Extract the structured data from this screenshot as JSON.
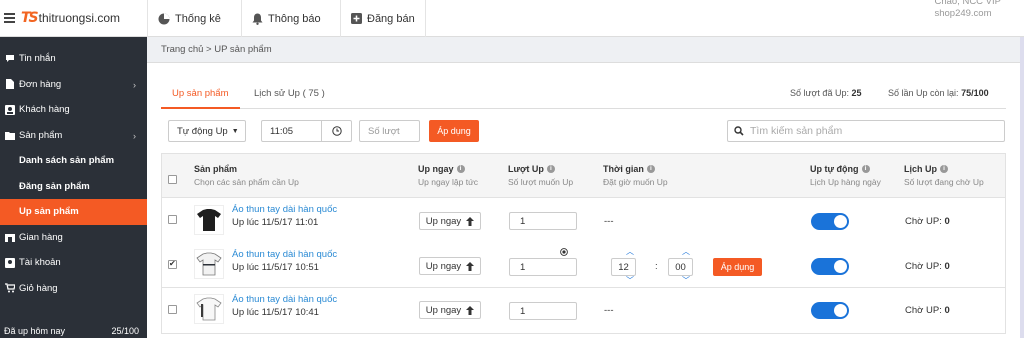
{
  "brand": {
    "name": "thitruongsi.com",
    "accent": "#f45a24"
  },
  "topbar": {
    "stats_label": "Thống kê",
    "notify_label": "Thông báo",
    "sell_label": "Đăng bán",
    "greeting": "Chào, NCC VIP",
    "shop": "shop249.com"
  },
  "sidebar": {
    "items": [
      {
        "label": "Tin nhắn",
        "icon": "chat-icon"
      },
      {
        "label": "Đơn hàng",
        "icon": "document-icon"
      },
      {
        "label": "Khách hàng",
        "icon": "contact-icon"
      },
      {
        "label": "Sản phẩm",
        "icon": "folder-icon"
      },
      {
        "label": "Danh sách sản phẩm"
      },
      {
        "label": "Đăng sản phẩm"
      },
      {
        "label": "Up sản phẩm"
      },
      {
        "label": "Gian hàng",
        "icon": "store-icon"
      },
      {
        "label": "Tài khoản",
        "icon": "account-icon"
      },
      {
        "label": "Giỏ hàng",
        "icon": "cart-icon"
      }
    ],
    "footer_label": "Đã up hôm nay",
    "footer_value": "25/100"
  },
  "breadcrumb": "Trang chủ > UP sản phẩm",
  "tabs": {
    "up": "Up sản phẩm",
    "history": "Lịch sử Up ( 75 )"
  },
  "stats": {
    "used_label": "Số lượt đã Up:",
    "used_value": "25",
    "remaining_label": "Số lần Up còn lại:",
    "remaining_value": "75/100"
  },
  "controls": {
    "mode": "Tự động Up",
    "time": "11:05",
    "turns_placeholder": "Số lượt",
    "apply": "Áp dụng",
    "search_placeholder": "Tìm kiếm sản phẩm"
  },
  "table": {
    "headers": [
      {
        "title": "Sản phẩm",
        "sub": "Chọn các sản phẩm cần Up"
      },
      {
        "title": "Up ngay",
        "sub": "Up ngay lập tức"
      },
      {
        "title": "Lượt Up",
        "sub": "Số lượt muốn Up"
      },
      {
        "title": "Thời gian",
        "sub": "Đặt giờ muốn Up"
      },
      {
        "title": "Up tự động",
        "sub": "Lịch Up hàng ngày"
      },
      {
        "title": "Lịch Up",
        "sub": "Số lượt đang chờ Up"
      }
    ],
    "rows": [
      {
        "name": "Áo thun tay dài hàn quốc",
        "time": "Up lúc 11/5/17 11:01",
        "up_now": "Up ngay",
        "turns": "1",
        "schedule": "---",
        "waiting_label": "Chờ UP:",
        "waiting": "0",
        "checked": false
      },
      {
        "name": "Áo thun tay dài hàn quốc",
        "time": "Up lúc 11/5/17 10:51",
        "up_now": "Up ngay",
        "turns": "1",
        "hour": "12",
        "minute": "00",
        "apply": "Áp dụng",
        "waiting_label": "Chờ UP:",
        "waiting": "0",
        "checked": true
      },
      {
        "name": "Áo thun tay dài hàn quốc",
        "time": "Up lúc 11/5/17 10:41",
        "up_now": "Up ngay",
        "turns": "1",
        "schedule": "---",
        "waiting_label": "Chờ UP:",
        "waiting": "0",
        "checked": false
      }
    ]
  }
}
